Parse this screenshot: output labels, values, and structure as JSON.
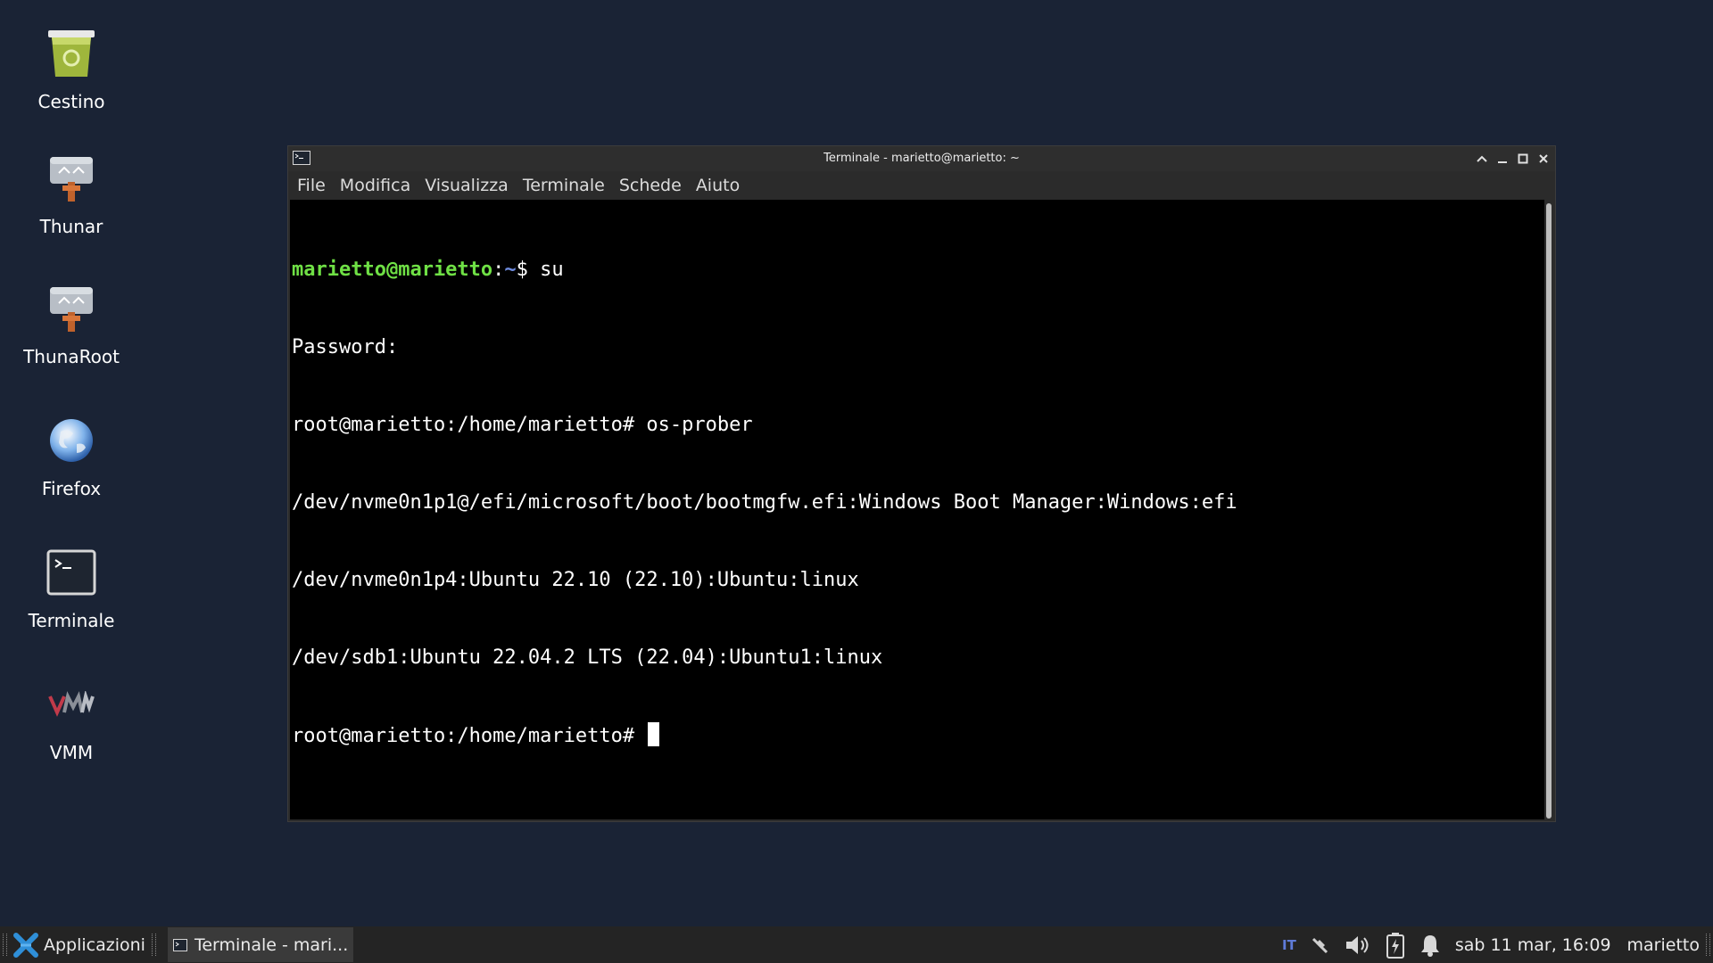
{
  "desktop": {
    "icons": [
      {
        "label": "Cestino",
        "icon": "trash-icon"
      },
      {
        "label": "Thunar",
        "icon": "file-manager-icon"
      },
      {
        "label": "ThunaRoot",
        "icon": "file-manager-root-icon"
      },
      {
        "label": "Firefox",
        "icon": "globe-icon"
      },
      {
        "label": "Terminale",
        "icon": "terminal-icon"
      },
      {
        "label": "VMM",
        "icon": "vmm-icon"
      }
    ]
  },
  "window": {
    "title": "Terminale - marietto@marietto: ~",
    "menu": [
      "File",
      "Modifica",
      "Visualizza",
      "Terminale",
      "Schede",
      "Aiuto"
    ],
    "terminal": {
      "prompt_user": "marietto@marietto",
      "prompt_colon": ":",
      "prompt_path": "~",
      "prompt_end": "$ ",
      "first_command": "su",
      "lines": [
        "Password:",
        "root@marietto:/home/marietto# os-prober",
        "/dev/nvme0n1p1@/efi/microsoft/boot/bootmgfw.efi:Windows Boot Manager:Windows:efi",
        "/dev/nvme0n1p4:Ubuntu 22.10 (22.10):Ubuntu:linux",
        "/dev/sdb1:Ubuntu 22.04.2 LTS (22.04):Ubuntu1:linux"
      ],
      "last_prompt": "root@marietto:/home/marietto# "
    }
  },
  "taskbar": {
    "apps_label": "Applicazioni",
    "task_label": "Terminale - mari...",
    "keyboard_layout": "IT",
    "clock": "sab 11 mar, 16:09",
    "user": "marietto"
  },
  "colors": {
    "desktop_bg": "#1a2335",
    "prompt_user": "#6fe045",
    "prompt_path": "#6f8ce0",
    "terminal_bg": "#000000",
    "taskbar_bg": "#242424"
  }
}
